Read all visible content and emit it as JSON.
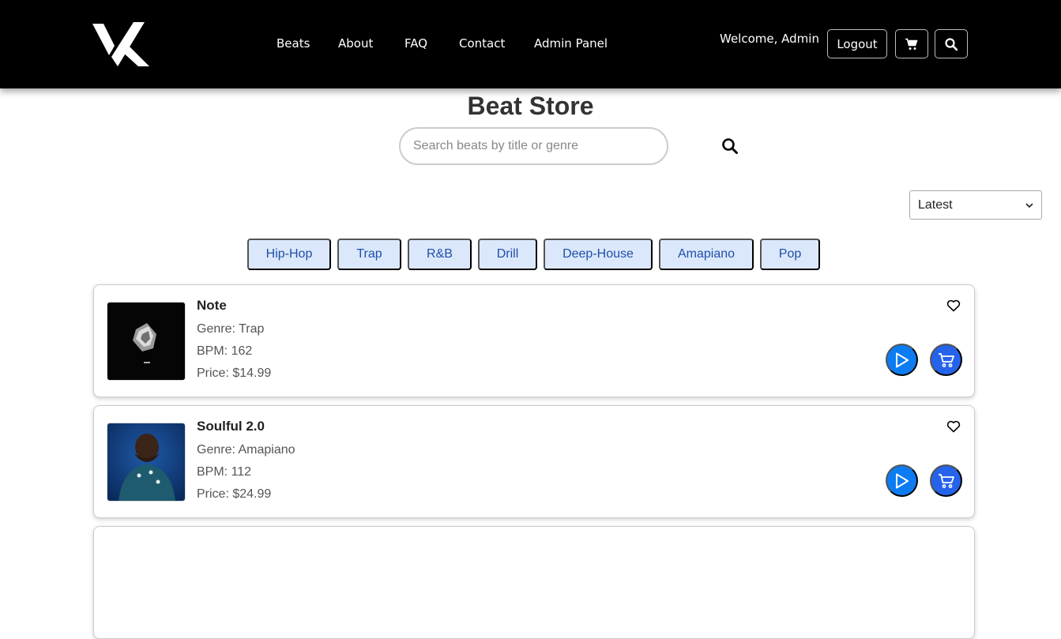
{
  "header": {
    "logo_text": "VK",
    "nav": [
      "Beats",
      "About",
      "FAQ",
      "Contact",
      "Admin Panel"
    ],
    "welcome": "Welcome, Admin",
    "logout_label": "Logout",
    "cart_icon": "cart-icon",
    "search_icon": "search-icon"
  },
  "main": {
    "title": "Beat Store",
    "search_placeholder": "Search beats by title or genre",
    "sort_selected": "Latest",
    "genres": [
      "Hip-Hop",
      "Trap",
      "R&B",
      "Drill",
      "Deep-House",
      "Amapiano",
      "Pop"
    ]
  },
  "beats": [
    {
      "title": "Note",
      "genre": "Genre: Trap",
      "bpm": "BPM: 162",
      "price": "Price: $14.99"
    },
    {
      "title": "Soulful 2.0",
      "genre": "Genre: Amapiano",
      "bpm": "BPM: 112",
      "price": "Price: $24.99"
    }
  ],
  "colors": {
    "header_bg": "#000000",
    "chip_bg": "#dbe8fb",
    "chip_text": "#1f4fa8",
    "play_button": "#0d7cf2",
    "cart_button": "#2563eb"
  }
}
